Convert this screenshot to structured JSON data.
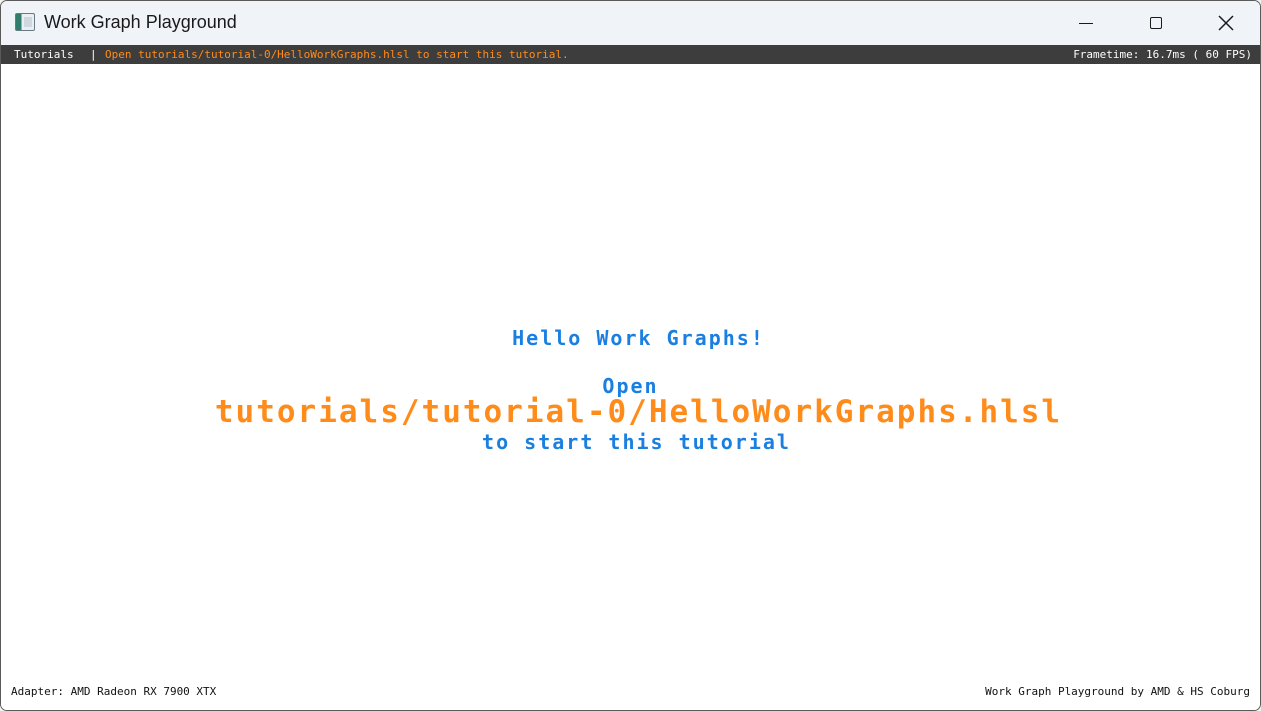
{
  "window": {
    "title": "Work Graph Playground",
    "icon": "app-window-icon"
  },
  "menubar": {
    "tutorials_label": "Tutorials",
    "separator": "|",
    "hint": "Open tutorials/tutorial-0/HelloWorkGraphs.hlsl to start this tutorial.",
    "frametime": "Frametime:  16.7ms ( 60 FPS)"
  },
  "canvas": {
    "heading": "Hello Work Graphs!",
    "open_word": "Open",
    "file_path": "tutorials/tutorial-0/HelloWorkGraphs.hlsl",
    "instruction": "to start this tutorial"
  },
  "footer": {
    "adapter": "Adapter: AMD Radeon RX 7900 XTX",
    "credits": "Work Graph Playground by AMD & HS Coburg"
  },
  "colors": {
    "accent_blue": "#1a7fe0",
    "accent_orange": "#ff8c1a",
    "menubar_bg": "#3d3d3d"
  }
}
